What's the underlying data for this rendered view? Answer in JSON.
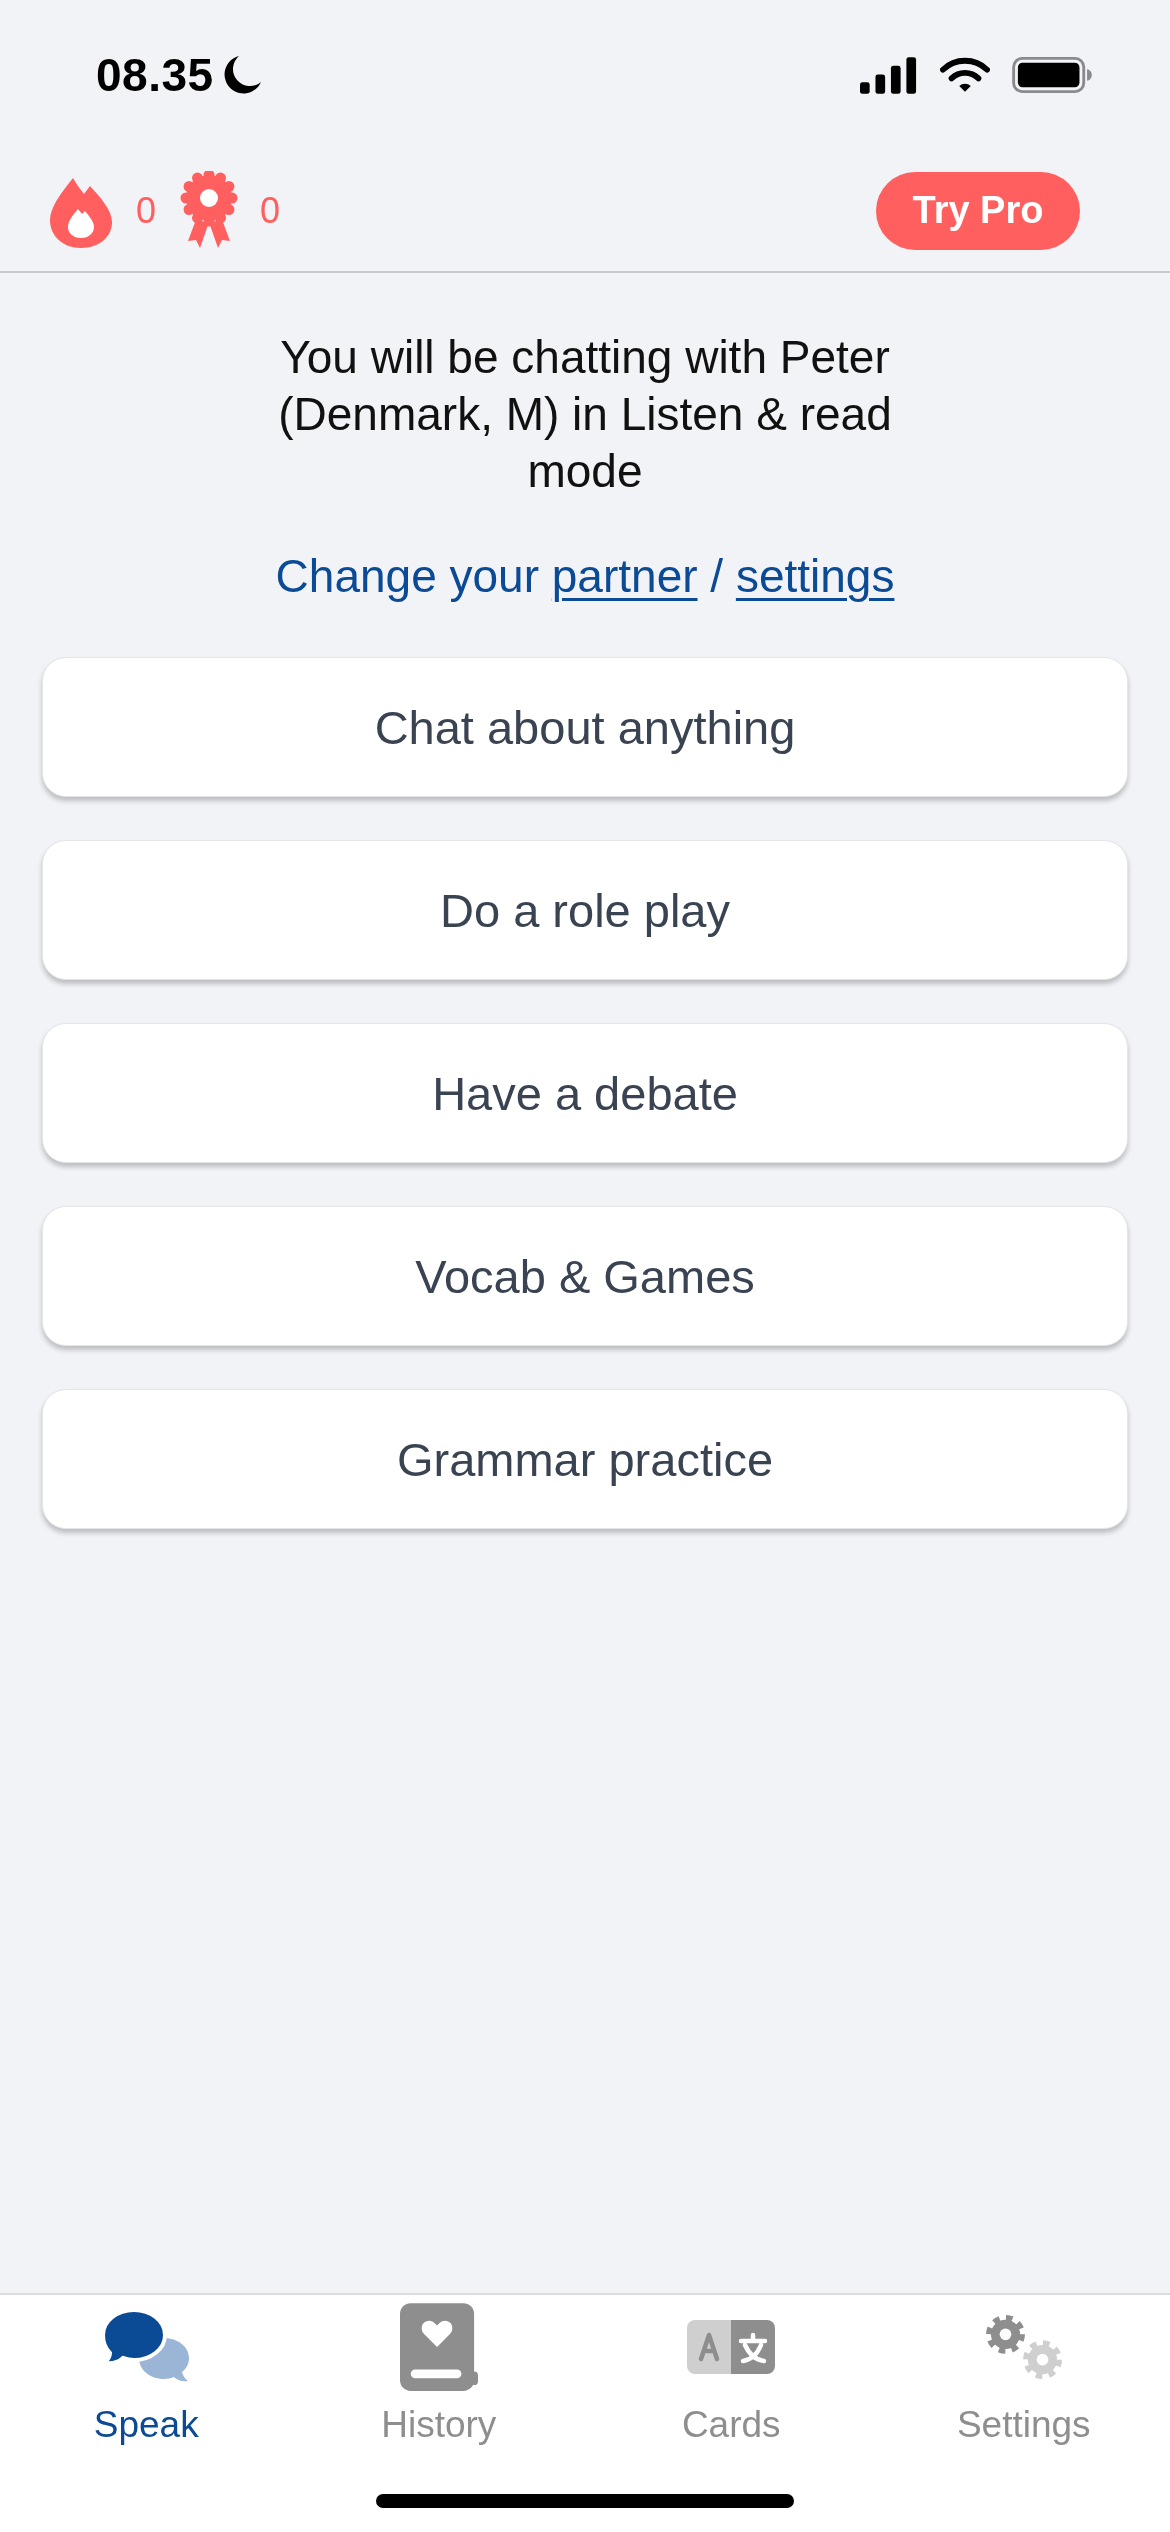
{
  "status_bar": {
    "time": "08.35"
  },
  "header": {
    "streak": {
      "count": "0"
    },
    "awards": {
      "count": "0"
    },
    "pro_button": "Try Pro"
  },
  "intro": {
    "text": "You will be chatting with Peter (Denmark, M) in Listen & read mode",
    "change_prefix": "Change your",
    "partner_link": "partner",
    "separator": "/",
    "settings_link": "settings"
  },
  "options": [
    "Chat about anything",
    "Do a role play",
    "Have a debate",
    "Vocab & Games",
    "Grammar practice"
  ],
  "tab_bar": [
    {
      "label": "Speak",
      "selected": true
    },
    {
      "label": "History",
      "selected": false
    },
    {
      "label": "Cards",
      "selected": false
    },
    {
      "label": "Settings",
      "selected": false
    }
  ]
}
